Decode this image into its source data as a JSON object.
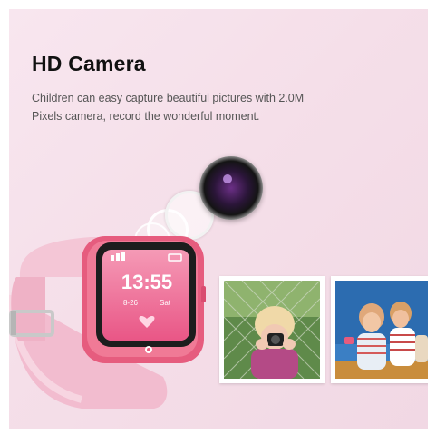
{
  "heading": "HD Camera",
  "description_line1": "Children can easy capture beautiful pictures with 2.0M",
  "description_line2": "Pixels camera, record the wonderful moment.",
  "watch": {
    "time": "13:55",
    "date": "8-26",
    "weekday": "Sat"
  },
  "colors": {
    "background": "#f5dfe9",
    "strap": "#f3bfd0",
    "watch_bezel": "#e8607f",
    "screen": "#f06a91",
    "heading": "#111111",
    "text": "#555555"
  }
}
